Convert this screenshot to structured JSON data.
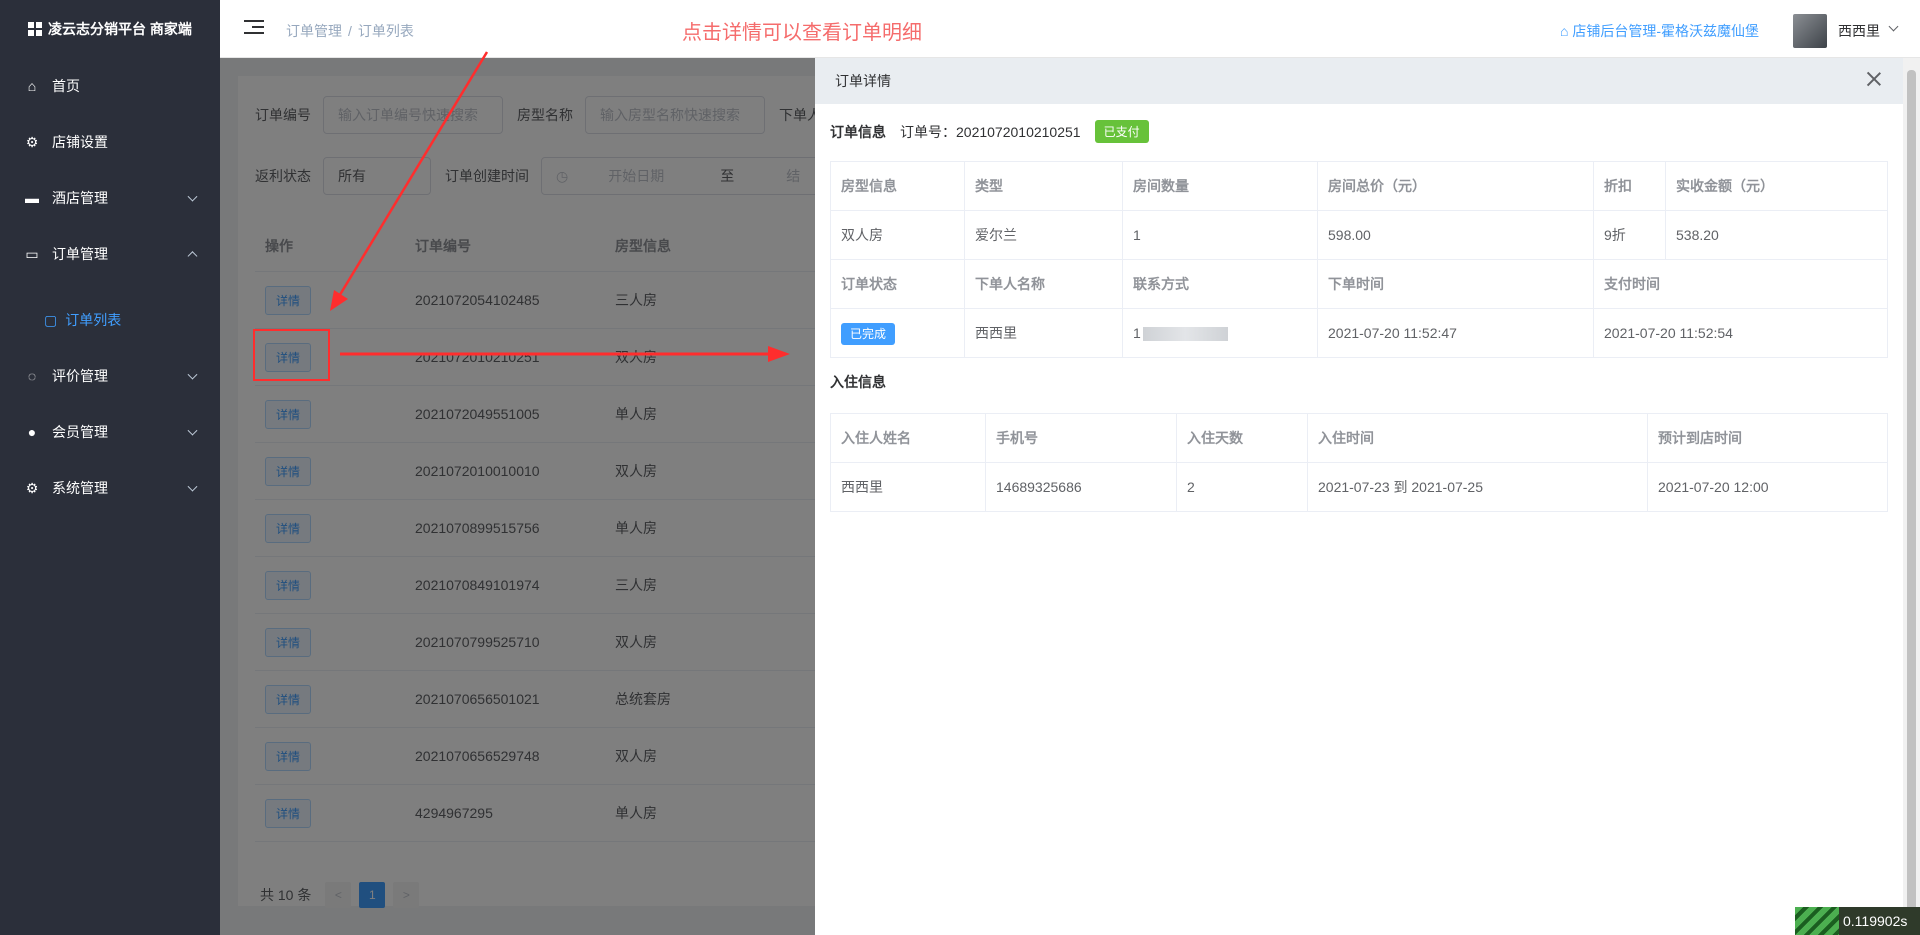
{
  "app": {
    "title": "凌云志分销平台 商家端"
  },
  "sidebar": {
    "items": [
      {
        "label": "首页",
        "icon": "home-icon"
      },
      {
        "label": "店铺设置",
        "icon": "gear-icon"
      },
      {
        "label": "酒店管理",
        "icon": "hotel-icon"
      },
      {
        "label": "订单管理",
        "icon": "monitor-icon"
      },
      {
        "label": "订单列表",
        "icon": "bag-icon"
      },
      {
        "label": "评价管理",
        "icon": "chat-icon"
      },
      {
        "label": "会员管理",
        "icon": "user-icon"
      },
      {
        "label": "系统管理",
        "icon": "gear-icon"
      }
    ]
  },
  "header": {
    "breadcrumb": [
      "订单管理",
      "订单列表"
    ],
    "breadcrumb_sep": "/",
    "annotation": "点击详情可以查看订单明细",
    "shop_link": "店铺后台管理-霍格沃兹魔仙堡",
    "username": "西西里"
  },
  "filters": {
    "order_no_label": "订单编号",
    "order_no_placeholder": "输入订单编号快速搜索",
    "room_type_label": "房型名称",
    "room_type_placeholder": "输入房型名称快速搜索",
    "buyer_label": "下单人",
    "rebate_label": "返利状态",
    "rebate_value": "所有",
    "created_label": "订单创建时间",
    "start_placeholder": "开始日期",
    "range_sep": "至",
    "end_placeholder": "结"
  },
  "table": {
    "headers": [
      "操作",
      "订单编号",
      "房型信息"
    ],
    "detail_label": "详情",
    "rows": [
      {
        "order_no": "2021072054102485",
        "room": "三人房"
      },
      {
        "order_no": "2021072010210251",
        "room": "双人房"
      },
      {
        "order_no": "2021072049551005",
        "room": "单人房"
      },
      {
        "order_no": "2021072010010010",
        "room": "双人房"
      },
      {
        "order_no": "2021070899515756",
        "room": "单人房"
      },
      {
        "order_no": "2021070849101974",
        "room": "三人房"
      },
      {
        "order_no": "2021070799525710",
        "room": "双人房"
      },
      {
        "order_no": "2021070656501021",
        "room": "总统套房"
      },
      {
        "order_no": "2021070656529748",
        "room": "双人房"
      },
      {
        "order_no": "4294967295",
        "room": "单人房"
      }
    ]
  },
  "pager": {
    "total": "共 10 条",
    "prev": "<",
    "current": "1",
    "next": ">"
  },
  "drawer": {
    "title": "订单详情",
    "order_info_label": "订单信息",
    "order_no_text": "订单号：2021072010210251",
    "paid_tag": "已支付",
    "order_headers1": [
      "房型信息",
      "类型",
      "房间数量",
      "房间总价（元）",
      "折扣",
      "实收金额（元）"
    ],
    "order_values1": [
      "双人房",
      "爱尔兰",
      "1",
      "598.00",
      "9折",
      "538.20"
    ],
    "order_headers2": [
      "订单状态",
      "下单人名称",
      "联系方式",
      "下单时间",
      "支付时间"
    ],
    "status_tag": "已完成",
    "buyer_name": "西西里",
    "contact_prefix": "1",
    "order_time": "2021-07-20 11:52:47",
    "pay_time": "2021-07-20 11:52:54",
    "checkin_label": "入住信息",
    "checkin_headers": [
      "入住人姓名",
      "手机号",
      "入住天数",
      "入住时间",
      "预计到店时间"
    ],
    "checkin_values": [
      "西西里",
      "14689325686",
      "2",
      "2021-07-23 到 2021-07-25",
      "2021-07-20 12:00"
    ]
  },
  "timing": {
    "value": "0.119902s"
  },
  "colors": {
    "sidebar_bg": "#2b2f3a",
    "primary": "#409eff",
    "success": "#67c23a",
    "annotation": "#f56c6c"
  }
}
